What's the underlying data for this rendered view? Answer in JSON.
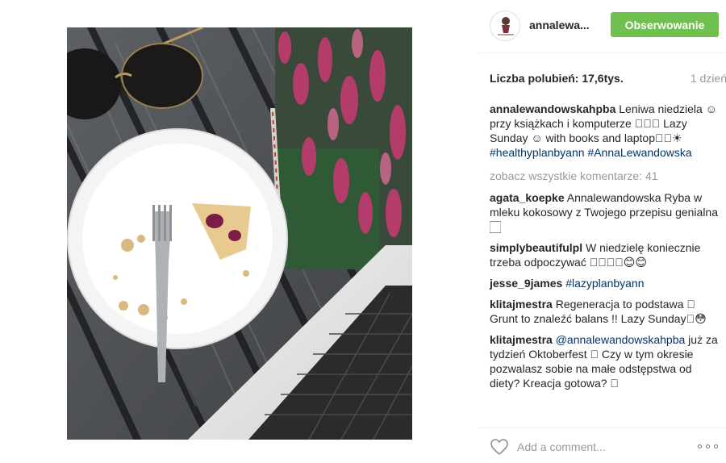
{
  "post": {
    "username": "annalewa...",
    "follow_label": "Obserwowanie",
    "likes_text": "Liczba polubień: 17,6tys.",
    "time_text": "1 dzień",
    "view_all_text": "zobacz wszystkie komentarze: 41",
    "add_comment_placeholder": "Add a comment...",
    "more_icon": "ellipsis-icon",
    "like_icon": "heart-icon"
  },
  "caption": {
    "user": "annalewandowskahpba",
    "text": "Leniwa niedziela ☺ przy książkach i komputerze 🏻☀🏻 Lazy Sunday ☺ with books and laptop🏻🏻☀",
    "tag1": "#healthyplanbyann",
    "tag2": "#AnnaLewandowska"
  },
  "comments": [
    {
      "user": "agata_koepke",
      "text": "Annalewandowska Ryba w mleku kokosowy z Twojego przepisu genialna 🏻"
    },
    {
      "user": "simplybeautifulpl",
      "text": "W niedzielę koniecznie trzeba odpoczywać 🏻🏻🏻🏻😊😊"
    },
    {
      "user": "jesse_9james",
      "tag": "#lazyplanbyann"
    },
    {
      "user": "klitajmestra",
      "text": "Regeneracja to podstawa 🏻 Grunt to znaleźć balans !! Lazy Sunday🏻😳"
    },
    {
      "user": "klitajmestra",
      "mention": "@annalewandowskahpba",
      "text": "już za tydzień Oktoberfest 🏻 Czy w tym okresie pozwalasz sobie na małe odstępstwa od diety? Kreacja gotowa? 🏻"
    }
  ],
  "colors": {
    "follow_green": "#70c050",
    "link_blue": "#003569",
    "muted_gray": "#999999"
  }
}
